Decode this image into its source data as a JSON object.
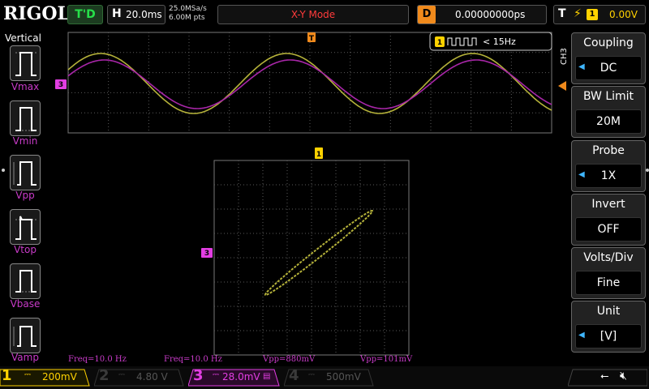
{
  "header": {
    "brand": "RIGOL",
    "trigger_status": "T'D",
    "horizontal_letter": "H",
    "timebase": "20.0ms",
    "sample_rate": "25.0MSa/s",
    "memory_depth": "6.00M pts",
    "mode": "X-Y Mode",
    "delay_letter": "D",
    "delay": "0.00000000ps",
    "trigger_letter": "T",
    "trigger_source": "1",
    "trigger_level": "0.00V"
  },
  "left_menu": {
    "title": "Vertical",
    "items": [
      {
        "label": "Vmax"
      },
      {
        "label": "Vmin"
      },
      {
        "label": "Vpp"
      },
      {
        "label": "Vtop"
      },
      {
        "label": "Vbase"
      },
      {
        "label": "Vamp"
      }
    ]
  },
  "right_menu": {
    "channel_tab": "CH3",
    "items": [
      {
        "title": "Coupling",
        "value": "DC"
      },
      {
        "title": "BW Limit",
        "value": "20M"
      },
      {
        "title": "Probe",
        "value": "1X"
      },
      {
        "title": "Invert",
        "value": "OFF"
      },
      {
        "title": "Volts/Div",
        "value": "Fine"
      },
      {
        "title": "Unit",
        "value": "[V]"
      }
    ]
  },
  "freq_counter": {
    "channel": "1",
    "value": "< 15Hz"
  },
  "markers": {
    "trigger_pos": "T",
    "ch3_level": "3",
    "xy_ch1": "1",
    "xy_ch3": "3"
  },
  "measurements": [
    {
      "text": "Freq=10.0 Hz"
    },
    {
      "text": "Freq=10.0 Hz"
    },
    {
      "text": "Vpp=880mV"
    },
    {
      "text": "Vpp=101mV"
    }
  ],
  "channels": [
    {
      "num": "1",
      "scale": "200mV",
      "color": "#ffd200",
      "active": true
    },
    {
      "num": "2",
      "scale": "4.80 V",
      "color": "#2fb8b8",
      "active": false
    },
    {
      "num": "3",
      "scale": "28.0mV",
      "color": "#e23ee2",
      "active": true
    },
    {
      "num": "4",
      "scale": "500mV",
      "color": "#3b6fd6",
      "active": false
    }
  ],
  "colors": {
    "ch1": "#b5b23a",
    "ch3": "#a826a8",
    "grid": "#5a5a5a",
    "trigger_marker": "#f08a1c"
  },
  "waveform": {
    "frequency_hz": 10.0,
    "ch1_vpp_v": 0.88,
    "ch3_vpp_v": 0.101
  }
}
